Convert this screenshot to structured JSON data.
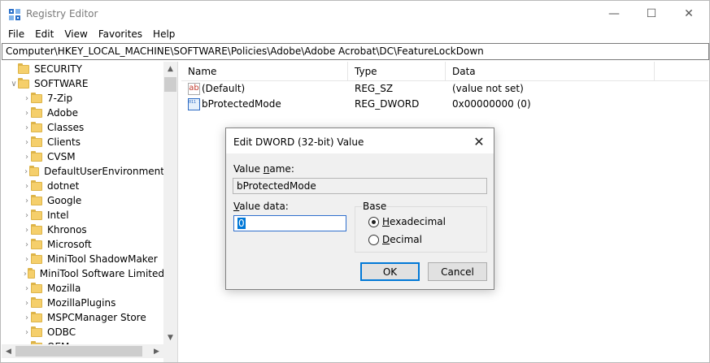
{
  "window": {
    "title": "Registry Editor",
    "controls": {
      "minimize": "—",
      "maximize": "☐",
      "close": "✕"
    }
  },
  "menu": [
    "File",
    "Edit",
    "View",
    "Favorites",
    "Help"
  ],
  "address": "Computer\\HKEY_LOCAL_MACHINE\\SOFTWARE\\Policies\\Adobe\\Adobe Acrobat\\DC\\FeatureLockDown",
  "tree": {
    "items": [
      {
        "label": "SECURITY",
        "expanded": false,
        "indent": 1,
        "chevron": ""
      },
      {
        "label": "SOFTWARE",
        "expanded": true,
        "indent": 1,
        "chevron": "∨"
      },
      {
        "label": "7-Zip",
        "indent": 2,
        "chevron": "›"
      },
      {
        "label": "Adobe",
        "indent": 2,
        "chevron": "›"
      },
      {
        "label": "Classes",
        "indent": 2,
        "chevron": "›"
      },
      {
        "label": "Clients",
        "indent": 2,
        "chevron": "›"
      },
      {
        "label": "CVSM",
        "indent": 2,
        "chevron": "›"
      },
      {
        "label": "DefaultUserEnvironment",
        "indent": 2,
        "chevron": "›"
      },
      {
        "label": "dotnet",
        "indent": 2,
        "chevron": "›"
      },
      {
        "label": "Google",
        "indent": 2,
        "chevron": "›"
      },
      {
        "label": "Intel",
        "indent": 2,
        "chevron": "›"
      },
      {
        "label": "Khronos",
        "indent": 2,
        "chevron": "›"
      },
      {
        "label": "Microsoft",
        "indent": 2,
        "chevron": "›"
      },
      {
        "label": "MiniTool ShadowMaker",
        "indent": 2,
        "chevron": "›"
      },
      {
        "label": "MiniTool Software Limited",
        "indent": 2,
        "chevron": "›"
      },
      {
        "label": "Mozilla",
        "indent": 2,
        "chevron": "›"
      },
      {
        "label": "MozillaPlugins",
        "indent": 2,
        "chevron": "›"
      },
      {
        "label": "MSPCManager Store",
        "indent": 2,
        "chevron": "›"
      },
      {
        "label": "ODBC",
        "indent": 2,
        "chevron": "›"
      },
      {
        "label": "OEM",
        "indent": 2,
        "chevron": "›"
      }
    ]
  },
  "list": {
    "columns": {
      "name": "Name",
      "type": "Type",
      "data": "Data"
    },
    "rows": [
      {
        "icon": "string-value-icon",
        "icon_text": "ab",
        "name": "(Default)",
        "type": "REG_SZ",
        "data": "(value not set)"
      },
      {
        "icon": "binary-value-icon",
        "icon_text": "011 110",
        "name": "bProtectedMode",
        "type": "REG_DWORD",
        "data": "0x00000000 (0)"
      }
    ]
  },
  "dialog": {
    "title": "Edit DWORD (32-bit) Value",
    "value_name_label_pre": "Value ",
    "value_name_label_u": "n",
    "value_name_label_post": "ame:",
    "value_name": "bProtectedMode",
    "value_data_label_pre": "",
    "value_data_label_u": "V",
    "value_data_label_post": "alue data:",
    "value_data": "0",
    "base_label": "Base",
    "base_options": [
      {
        "u": "H",
        "rest": "exadecimal",
        "selected": true
      },
      {
        "u": "D",
        "rest": "ecimal",
        "selected": false
      }
    ],
    "ok_label": "OK",
    "cancel_label": "Cancel"
  },
  "colors": {
    "accent": "#0078d7",
    "folder": "#f5cf6b"
  }
}
